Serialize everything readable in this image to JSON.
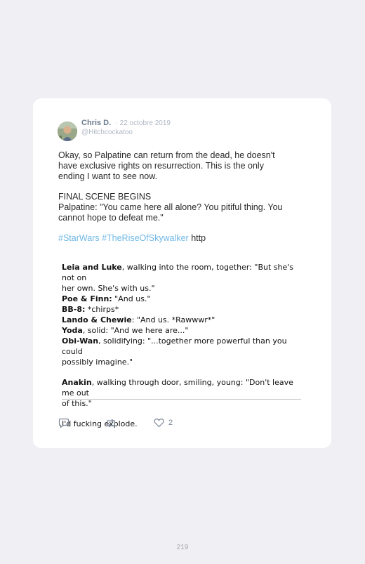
{
  "tweet": {
    "author": {
      "name": "Chris D.",
      "separator": "·",
      "date": "22 octobre 2019",
      "handle": "@Hitchcockatoo"
    },
    "text_lines_1": [
      "Okay, so Palpatine can return from the dead, he doesn't",
      "have exclusive rights on resurrection. This is the only",
      "ending I want to see now."
    ],
    "text_lines_2": [
      "FINAL SCENE BEGINS",
      "Palpatine: \"You came here all alone? You pitiful thing. You",
      "cannot hope to defeat me.\""
    ],
    "hashtags": [
      "#StarWars",
      "#TheRiseOfSkywalker"
    ],
    "link": "http",
    "quote": [
      {
        "bold": "Leia and Luke",
        "rest": ", walking into the room, together: ",
        "bold2": "",
        "rest2": "\"But she's not on"
      },
      {
        "bold": "",
        "rest": "her own. She's with us.\"",
        "bold2": "",
        "rest2": ""
      },
      {
        "bold": "Poe & Finn:",
        "rest": " \"And us.\"",
        "bold2": "",
        "rest2": ""
      },
      {
        "bold": "BB-8:",
        "rest": " *chirps*",
        "bold2": "",
        "rest2": ""
      },
      {
        "bold": "Lando & Chewie",
        "rest": ": \"And us. *Rawwwr*\"",
        "bold2": "",
        "rest2": ""
      },
      {
        "bold": "Yoda",
        "rest": ", solid: \"And we here are...\"",
        "bold2": "",
        "rest2": ""
      },
      {
        "bold": "Obi-Wan",
        "rest": ", solidifying: \"...together more powerful than you could",
        "bold2": "",
        "rest2": ""
      },
      {
        "bold": "",
        "rest": "possibly imagine.\"",
        "bold2": "",
        "rest2": ""
      },
      {
        "gap": true
      },
      {
        "bold": "Anakin",
        "rest": ", walking through door, smiling, young: \"Don't leave me out",
        "bold2": "",
        "rest2": ""
      },
      {
        "bold": "",
        "rest": "of this.\"",
        "bold2": "",
        "rest2": ""
      },
      {
        "gap": true
      },
      {
        "bold": "",
        "rest": "I'd fucking explode.",
        "bold2": "",
        "rest2": ""
      }
    ],
    "like_count": "2",
    "icons": [
      "reply-icon",
      "retweet-icon",
      "heart-icon"
    ]
  },
  "page_number": "219",
  "colors": {
    "background": "#efeff4",
    "card": "#ffffff",
    "hashtag": "#6fb8e6",
    "muted": "#b0b8c4"
  }
}
